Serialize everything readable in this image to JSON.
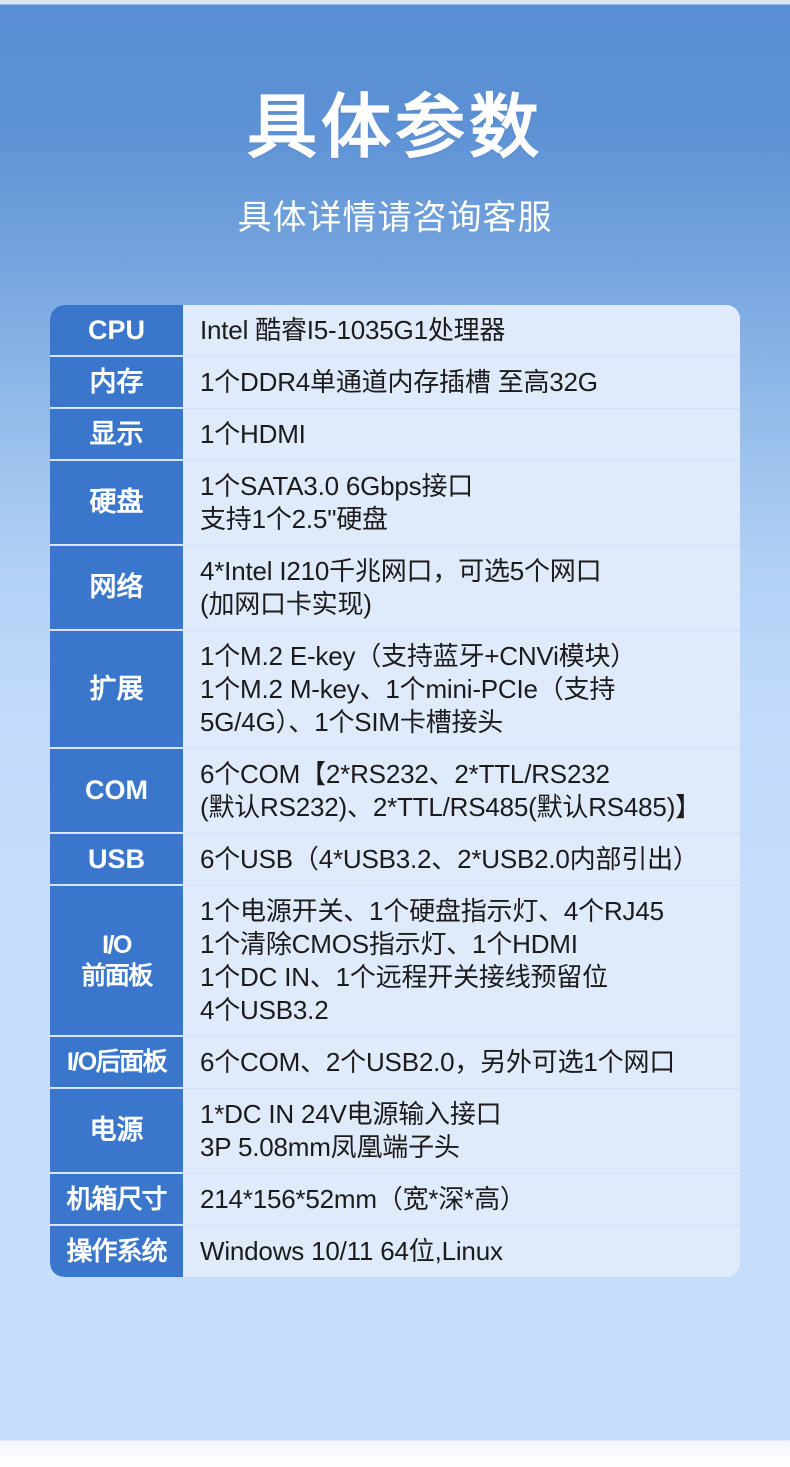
{
  "header": {
    "title": "具体参数",
    "subtitle": "具体详情请咨询客服"
  },
  "colors": {
    "label_blue": "#3a77cc",
    "value_bg": "#dfeafb",
    "bg_top": "#5a8ed4",
    "bg_bottom": "#c6ddfc",
    "title_text": "#ffffff",
    "value_text": "#1b1b1b"
  },
  "spec_table": {
    "rows": [
      {
        "label": "CPU",
        "value": "Intel 酷睿I5-1035G1处理器"
      },
      {
        "label": "内存",
        "value": "1个DDR4单通道内存插槽 至高32G"
      },
      {
        "label": "显示",
        "value": "1个HDMI"
      },
      {
        "label": "硬盘",
        "value": "1个SATA3.0 6Gbps接口\n支持1个2.5\"硬盘"
      },
      {
        "label": "网络",
        "value": "4*Intel I210千兆网口，可选5个网口\n(加网口卡实现)"
      },
      {
        "label": "扩展",
        "value": "1个M.2 E-key（支持蓝牙+CNVi模块）\n1个M.2 M-key、1个mini-PCIe（支持\n5G/4G）、1个SIM卡槽接头"
      },
      {
        "label": "COM",
        "value": "6个COM【2*RS232、2*TTL/RS232\n(默认RS232)、2*TTL/RS485(默认RS485)】"
      },
      {
        "label": "USB",
        "value": "6个USB（4*USB3.2、2*USB2.0内部引出）"
      },
      {
        "label": "I/O\n前面板",
        "value": "1个电源开关、1个硬盘指示灯、4个RJ45\n1个清除CMOS指示灯、1个HDMI\n1个DC IN、1个远程开关接线预留位\n4个USB3.2"
      },
      {
        "label": "I/O后面板",
        "value": "6个COM、2个USB2.0，另外可选1个网口"
      },
      {
        "label": "电源",
        "value": "1*DC IN 24V电源输入接口\n3P 5.08mm凤凰端子头"
      },
      {
        "label": "机箱尺寸",
        "value": "214*156*52mm（宽*深*高）"
      },
      {
        "label": "操作系统",
        "value": "Windows 10/11 64位,Linux"
      }
    ]
  }
}
